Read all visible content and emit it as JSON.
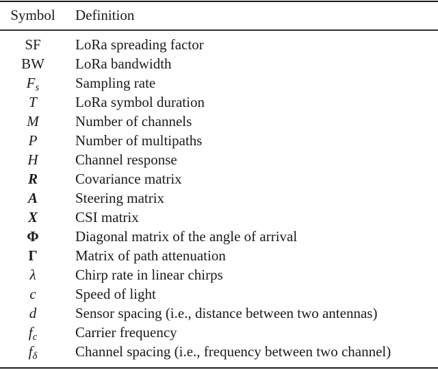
{
  "table": {
    "headers": {
      "symbol": "Symbol",
      "definition": "Definition"
    },
    "rows": [
      {
        "symbol": "SF",
        "sub": "",
        "style": "roman",
        "definition": "LoRa spreading factor"
      },
      {
        "symbol": "BW",
        "sub": "",
        "style": "roman",
        "definition": "LoRa bandwidth"
      },
      {
        "symbol": "F",
        "sub": "s",
        "style": "italic",
        "definition": "Sampling rate"
      },
      {
        "symbol": "T",
        "sub": "",
        "style": "italic",
        "definition": "LoRa symbol duration"
      },
      {
        "symbol": "M",
        "sub": "",
        "style": "italic",
        "definition": "Number of channels"
      },
      {
        "symbol": "P",
        "sub": "",
        "style": "italic",
        "definition": "Number of multipaths"
      },
      {
        "symbol": "H",
        "sub": "",
        "style": "italic",
        "definition": "Channel response"
      },
      {
        "symbol": "R",
        "sub": "",
        "style": "bold-italic",
        "definition": "Covariance matrix"
      },
      {
        "symbol": "A",
        "sub": "",
        "style": "bold-italic",
        "definition": "Steering matrix"
      },
      {
        "symbol": "X",
        "sub": "",
        "style": "bold-italic",
        "definition": "CSI matrix"
      },
      {
        "symbol": "Φ",
        "sub": "",
        "style": "bold",
        "definition": "Diagonal matrix of the angle of arrival"
      },
      {
        "symbol": "Γ",
        "sub": "",
        "style": "bold",
        "definition": "Matrix of path attenuation"
      },
      {
        "symbol": "λ",
        "sub": "",
        "style": "italic",
        "definition": "Chirp rate in linear chirps"
      },
      {
        "symbol": "c",
        "sub": "",
        "style": "italic",
        "definition": "Speed of light"
      },
      {
        "symbol": "d",
        "sub": "",
        "style": "italic",
        "definition": "Sensor spacing (i.e., distance between two antennas)"
      },
      {
        "symbol": "f",
        "sub": "c",
        "style": "italic",
        "definition": "Carrier frequency"
      },
      {
        "symbol": "f",
        "sub": "δ",
        "style": "italic",
        "definition": "Channel spacing (i.e., frequency between two channel)"
      }
    ]
  }
}
